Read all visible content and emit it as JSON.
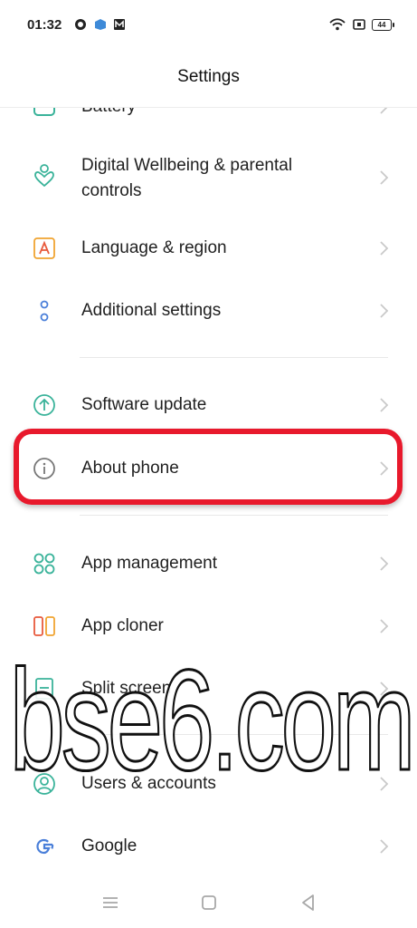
{
  "status_bar": {
    "time": "01:32",
    "battery_level": "44"
  },
  "header": {
    "title": "Settings"
  },
  "rows": [
    {
      "label": "Battery",
      "icon": "battery-icon"
    },
    {
      "label": "Digital Wellbeing & parental controls",
      "icon": "heart-person-icon"
    },
    {
      "label": "Language & region",
      "icon": "language-icon"
    },
    {
      "label": "Additional settings",
      "icon": "dots-icon"
    },
    {
      "label": "Software update",
      "icon": "update-arrow-icon"
    },
    {
      "label": "About phone",
      "icon": "info-icon"
    },
    {
      "label": "App management",
      "icon": "apps-grid-icon"
    },
    {
      "label": "App cloner",
      "icon": "cloner-icon"
    },
    {
      "label": "Split screen",
      "icon": "split-screen-icon"
    },
    {
      "label": "Users & accounts",
      "icon": "user-icon"
    },
    {
      "label": "Google",
      "icon": "google-icon"
    }
  ],
  "watermark": {
    "text": "bse6.com"
  },
  "colors": {
    "highlight": "#e8192c",
    "teal": "#3ab39a",
    "orange": "#f0a431",
    "blue": "#4a7fd9"
  }
}
